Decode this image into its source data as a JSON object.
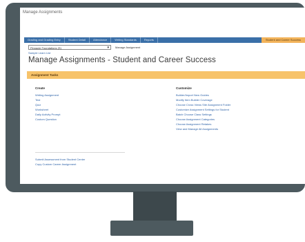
{
  "window": {
    "title": "Manage Assignments"
  },
  "tabs": [
    "Grading and Grading Entry",
    "Student Detail",
    "Attendance",
    "Writing Standards",
    "Reports",
    "Student and Career Success"
  ],
  "selector": {
    "value": "Pinnacle Foundations (S)",
    "label": "Manage Assignment"
  },
  "sub_link": "Sample Learn List",
  "page_title": "Manage Assignments - Student and Career Success",
  "section": {
    "title": "Assignment Tasks"
  },
  "create": {
    "heading": "Create",
    "items": [
      "Writing Assignment",
      "Test",
      "Quiz",
      "Worksheet",
      "Daily Activity Prompt",
      "Custom Question"
    ]
  },
  "customize": {
    "heading": "Customize",
    "items": [
      "Builder/Import New Guides",
      "Modify Item Builder Coverage",
      "Choose Cross Views Site Assignment Folder",
      "Customize Assignment Settings for Student",
      "Batch Choose Class Settings",
      "Choose Assignment Categories",
      "Choose Assignment Retakes",
      "View and Manage All Assignments"
    ]
  },
  "bottom_links": [
    "Submit Assessment from Student Center",
    "Copy Custom Career Assignment"
  ]
}
